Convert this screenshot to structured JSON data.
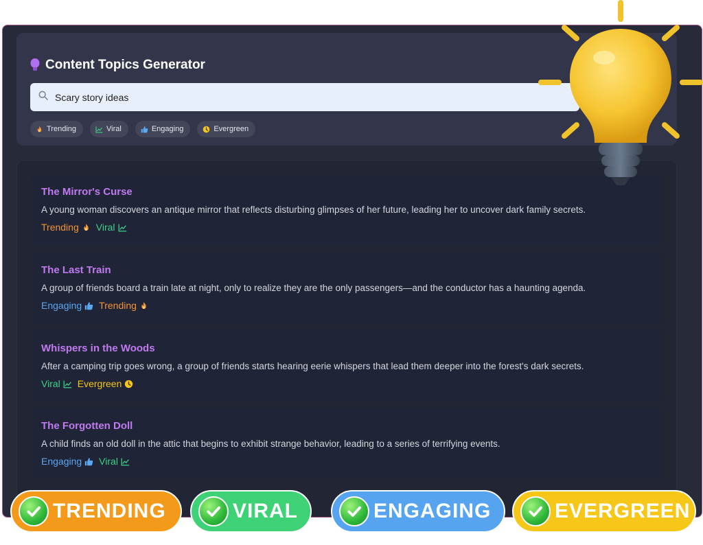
{
  "app": {
    "title": "Content Topics Generator"
  },
  "search": {
    "value": "Scary story ideas",
    "icon": "search-icon"
  },
  "filters": [
    {
      "label": "Trending",
      "icon": "flame-icon",
      "color": "#f59436"
    },
    {
      "label": "Viral",
      "icon": "chart-line-icon",
      "color": "#3fd18a"
    },
    {
      "label": "Engaging",
      "icon": "thumbs-up-icon",
      "color": "#5aa7f2"
    },
    {
      "label": "Evergreen",
      "icon": "clock-icon",
      "color": "#f5c518"
    }
  ],
  "topics": [
    {
      "title": "The Mirror's Curse",
      "description": "A young woman discovers an antique mirror that reflects disturbing glimpses of her future, leading her to uncover dark family secrets.",
      "tags": [
        "Trending",
        "Viral"
      ]
    },
    {
      "title": "The Last Train",
      "description": "A group of friends board a train late at night, only to realize they are the only passengers—and the conductor has a haunting agenda.",
      "tags": [
        "Engaging",
        "Trending"
      ]
    },
    {
      "title": "Whispers in the Woods",
      "description": "After a camping trip goes wrong, a group of friends starts hearing eerie whispers that lead them deeper into the forest's dark secrets.",
      "tags": [
        "Viral",
        "Evergreen"
      ]
    },
    {
      "title": "The Forgotten Doll",
      "description": "A child finds an old doll in the attic that begins to exhibit strange behavior, leading to a series of terrifying events.",
      "tags": [
        "Engaging",
        "Viral"
      ]
    }
  ],
  "badges": [
    {
      "label": "TRENDING",
      "color": "#f39a1a"
    },
    {
      "label": "VIRAL",
      "color": "#3fd175"
    },
    {
      "label": "ENGAGING",
      "color": "#56a3f0"
    },
    {
      "label": "EVERGREEN",
      "color": "#f6c718"
    }
  ],
  "colors": {
    "accent_title": "#c07af0",
    "background": "#272a38",
    "card": "#1f2536"
  }
}
